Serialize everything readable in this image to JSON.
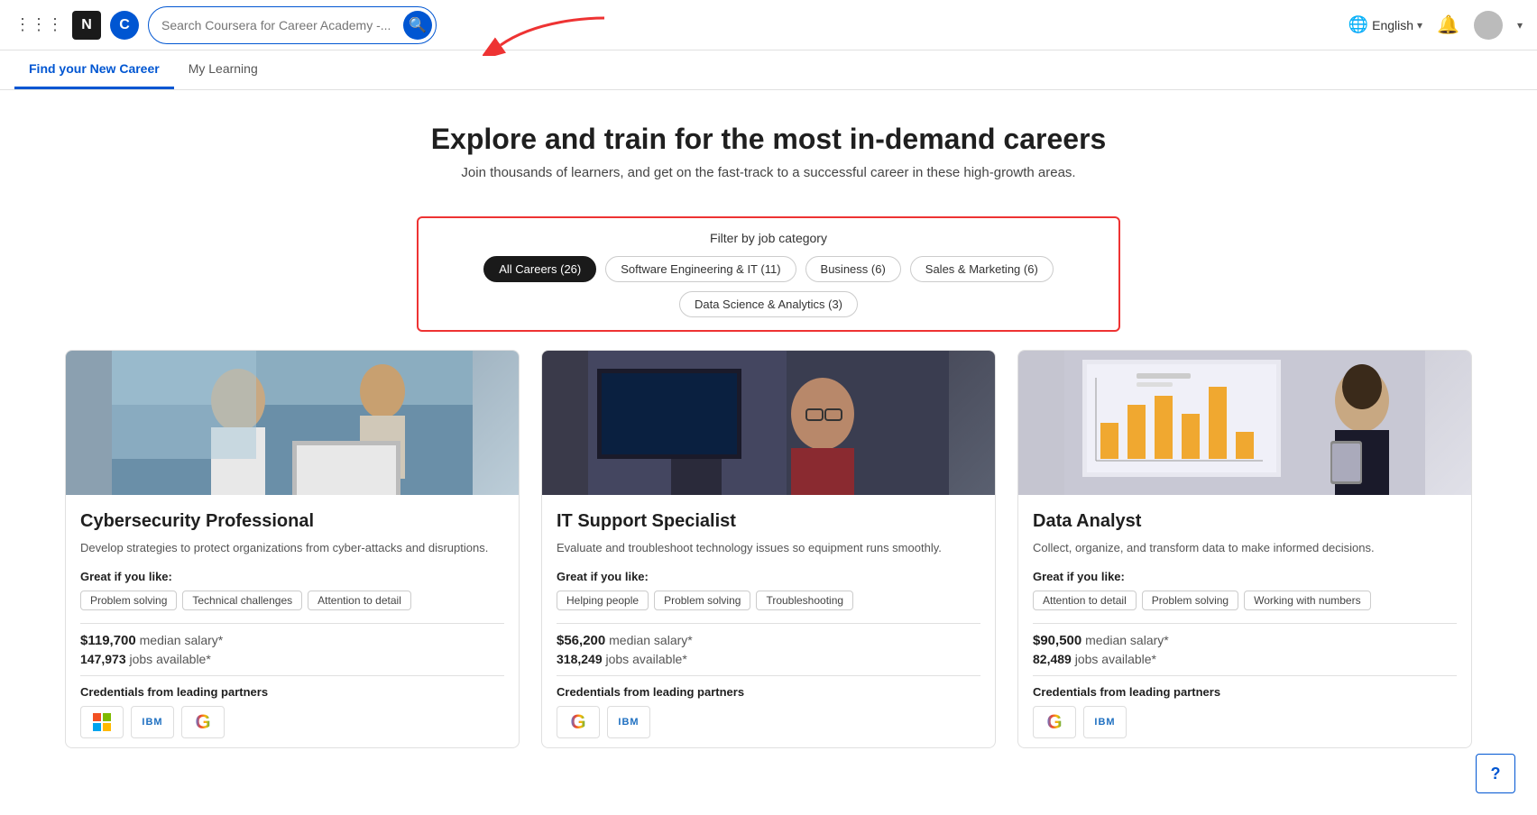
{
  "header": {
    "search_placeholder": "Search Coursera for Career Academy -...",
    "lang_label": "English",
    "coursera_letter": "C",
    "n_letter": "N"
  },
  "nav": {
    "tab1": "Find your New Career",
    "tab2": "My Learning"
  },
  "hero": {
    "title": "Explore and train for the most in-demand careers",
    "subtitle": "Join thousands of learners, and get on the fast-track to a successful career in these high-growth areas."
  },
  "filter": {
    "label": "Filter by job category",
    "chips": [
      {
        "id": "all",
        "label": "All Careers (26)",
        "active": true
      },
      {
        "id": "software",
        "label": "Software Engineering & IT (11)",
        "active": false
      },
      {
        "id": "business",
        "label": "Business (6)",
        "active": false
      },
      {
        "id": "sales",
        "label": "Sales & Marketing (6)",
        "active": false
      },
      {
        "id": "data",
        "label": "Data Science & Analytics (3)",
        "active": false
      }
    ]
  },
  "cards": [
    {
      "title": "Cybersecurity Professional",
      "description": "Develop strategies to protect organizations from cyber-attacks and disruptions.",
      "like_label": "Great if you like:",
      "tags": [
        "Problem solving",
        "Technical challenges",
        "Attention to detail"
      ],
      "salary_label": "median salary*",
      "salary_value": "$119,700",
      "jobs_value": "147,973",
      "jobs_label": "jobs available*",
      "partners_label": "Credentials from leading partners",
      "partners": [
        "Microsoft",
        "IBM",
        "Google"
      ]
    },
    {
      "title": "IT Support Specialist",
      "description": "Evaluate and troubleshoot technology issues so equipment runs smoothly.",
      "like_label": "Great if you like:",
      "tags": [
        "Helping people",
        "Problem solving",
        "Troubleshooting"
      ],
      "salary_label": "median salary*",
      "salary_value": "$56,200",
      "jobs_value": "318,249",
      "jobs_label": "jobs available*",
      "partners_label": "Credentials from leading partners",
      "partners": [
        "Google",
        "IBM"
      ]
    },
    {
      "title": "Data Analyst",
      "description": "Collect, organize, and transform data to make informed decisions.",
      "like_label": "Great if you like:",
      "tags": [
        "Attention to detail",
        "Problem solving",
        "Working with numbers"
      ],
      "salary_label": "median salary*",
      "salary_value": "$90,500",
      "jobs_value": "82,489",
      "jobs_label": "jobs available*",
      "partners_label": "Credentials from leading partners",
      "partners": [
        "Google",
        "IBM"
      ]
    }
  ],
  "help_icon": "?"
}
